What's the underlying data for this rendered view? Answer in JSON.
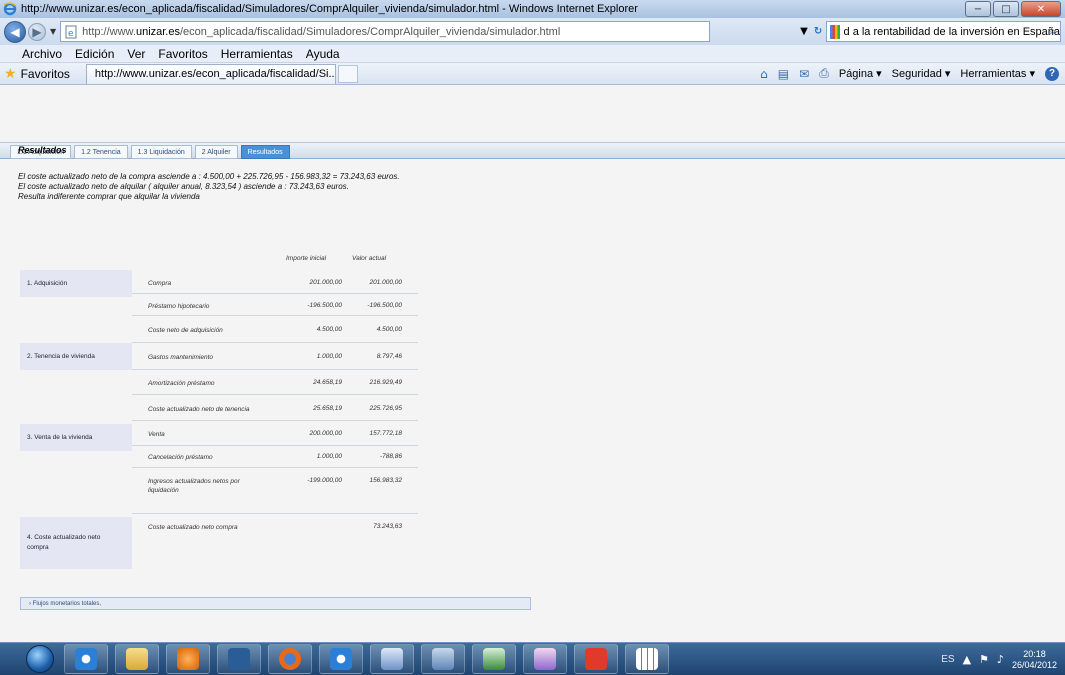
{
  "window": {
    "title": "http://www.unizar.es/econ_aplicada/fiscalidad/Simuladores/ComprAlquiler_vivienda/simulador.html - Windows Internet Explorer",
    "min_label": "−",
    "max_label": "□",
    "close_label": "✕"
  },
  "addressbar": {
    "url_prefix": "http://www.",
    "url_host": "unizar.es",
    "url_rest": "/econ_aplicada/fiscalidad/Simuladores/ComprAlquiler_vivienda/simulador.html",
    "search_text": "d a la rentabilidad de la inversión en España"
  },
  "menu": [
    "Archivo",
    "Edición",
    "Ver",
    "Favoritos",
    "Herramientas",
    "Ayuda"
  ],
  "favorites": {
    "label": "Favoritos",
    "tab_title": "http://www.unizar.es/econ_aplicada/fiscalidad/Si..."
  },
  "commandbar": {
    "pagina": "Página ▾",
    "seguridad": "Seguridad ▾",
    "herramientas": "Herramientas ▾"
  },
  "site_tabs": [
    "1.1 Adquisición",
    "1.2 Tenencia",
    "1.3 Liquidación",
    "2 Alquiler",
    "Resultados"
  ],
  "active_tab": 4,
  "results": {
    "heading": "Resultados",
    "line1": "El coste actualizado neto de la compra asciende a : 4.500,00 + 225.726,95 - 156.983,32 = 73.243,63 euros.",
    "line2": "El coste actualizado neto de alquilar ( alquiler anual, 8.323,54 ) asciende a : 73.243,63 euros.",
    "line3": "Resulta indiferente comprar que alquilar la vivienda"
  },
  "table": {
    "col_initial": "Importe inicial",
    "col_current": "Valor actual",
    "sections": [
      {
        "label": "1. Adquisición"
      },
      {
        "label": "2. Tenencia de vivienda"
      },
      {
        "label": "3. Venta de la vivienda"
      },
      {
        "label": "4. Coste actualizado neto compra"
      }
    ],
    "rows": [
      {
        "label": "Compra",
        "initial": "201.000,00",
        "current": "201.000,00"
      },
      {
        "label": "Préstamo hipotecario",
        "initial": "-196.500,00",
        "current": "-196.500,00"
      },
      {
        "label": "Coste neto de adquisición",
        "initial": "4.500,00",
        "current": "4.500,00"
      },
      {
        "label": "Gastos mantenimiento",
        "initial": "1.000,00",
        "current": "8.797,46"
      },
      {
        "label": "Amortización préstamo",
        "initial": "24.658,19",
        "current": "216.929,49"
      },
      {
        "label": "Coste actualizado neto de tenencia",
        "initial": "25.658,19",
        "current": "225.726,95"
      },
      {
        "label": "Venta",
        "initial": "200.000,00",
        "current": "157.772,18"
      },
      {
        "label": "Cancelación préstamo",
        "initial": "1.000,00",
        "current": "-788,86"
      },
      {
        "label": "Ingresos actualizados netos por liquidación",
        "initial": "-199.000,00",
        "current": "156.983,32"
      },
      {
        "label": "Coste actualizado neto compra",
        "initial": "",
        "current": "73.243,63"
      }
    ]
  },
  "flujos": "› Flujos monetarios totales,",
  "taskbar": {
    "lang": "ES",
    "time": "20:18",
    "date": "26/04/2012"
  }
}
